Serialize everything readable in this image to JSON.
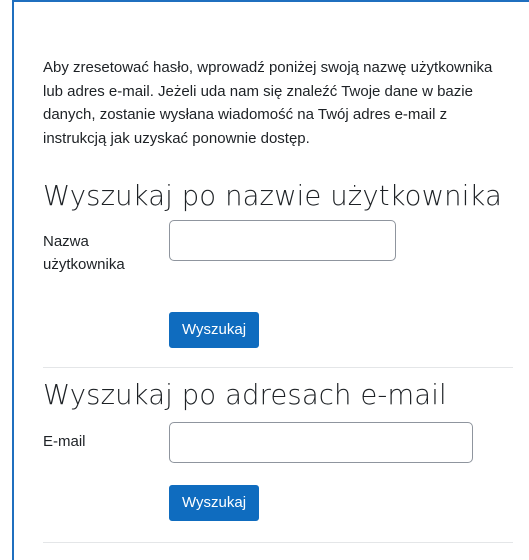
{
  "intro_text": "Aby zresetować hasło, wprowadź poniżej swoją nazwę użytkownika lub adres e-mail. Jeżeli uda nam się znaleźć Twoje dane w bazie danych, zostanie wysłana wiadomość na Twój adres e-mail z instrukcją jak uzyskać ponownie dostęp.",
  "username_section": {
    "title": "Wyszukaj po nazwie użytkownika",
    "field_label": "Nazwa użytkownika",
    "field_value": "",
    "button_label": "Wyszukaj"
  },
  "email_section": {
    "title": "Wyszukaj po adresach e-mail",
    "field_label": "E-mail",
    "field_value": "",
    "button_label": "Wyszukaj"
  },
  "colors": {
    "accent": "#0f6cbf",
    "frame_border": "#1f6fbf",
    "text": "#1d2125"
  }
}
